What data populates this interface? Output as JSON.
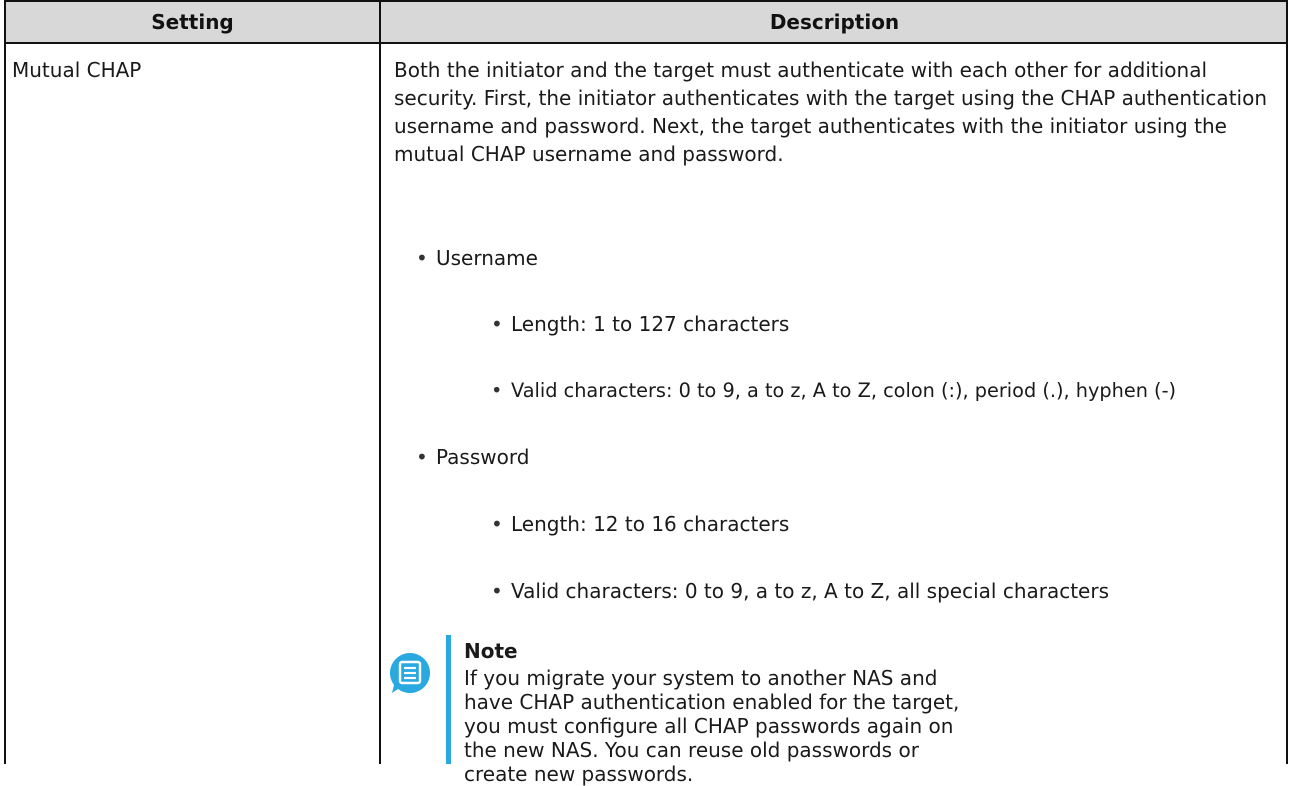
{
  "table": {
    "header": {
      "setting": "Setting",
      "description": "Description"
    },
    "row": {
      "setting": "Mutual CHAP",
      "intro": "Both the initiator and the target must authenticate with each other for additional security. First, the initiator authenticates with the target using the CHAP authentication username and password. Next, the target authenticates with the initiator using the mutual CHAP username and password.",
      "username": {
        "label": "Username",
        "length": "Length: 1 to 127 characters",
        "valid": "Valid characters: 0 to 9, a to z, A to Z, colon (:), period (.), hyphen (-)"
      },
      "password": {
        "label": "Password",
        "length": "Length: 12 to 16 characters",
        "valid": "Valid characters: 0 to 9, a to z, A to Z, all special characters"
      },
      "note": {
        "title": "Note",
        "text": "If you migrate your system to another NAS and have CHAP authentication enabled for the target, you must configure all CHAP passwords again on the new NAS. You can reuse old passwords or create new passwords.",
        "icon": "note-icon"
      }
    }
  },
  "colors": {
    "header_bg": "#d8d8d8",
    "note_accent": "#29a9e0",
    "border": "#111111"
  }
}
